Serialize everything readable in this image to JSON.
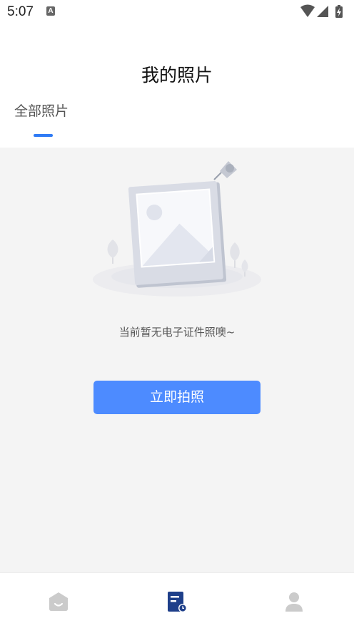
{
  "status_bar": {
    "time": "5:07",
    "notification_icon_letter": "A",
    "icons": [
      "wifi-icon",
      "signal-icon",
      "battery-charging-icon"
    ]
  },
  "header": {
    "title": "我的照片"
  },
  "tabs": [
    {
      "label": "全部照片",
      "active": true
    }
  ],
  "empty_state": {
    "illustration": "photo-placeholder-icon",
    "message": "当前暂无电子证件照噢~"
  },
  "primary_action": {
    "label": "立即拍照"
  },
  "bottom_nav": {
    "items": [
      {
        "icon": "home-icon",
        "active": false
      },
      {
        "icon": "orders-icon",
        "active": true
      },
      {
        "icon": "profile-icon",
        "active": false
      }
    ]
  },
  "colors": {
    "accent": "#2f7bf5",
    "button": "#4d8bff",
    "nav_active": "#1e3f8a",
    "nav_inactive": "#c9c9c9",
    "content_bg": "#f4f4f4"
  }
}
